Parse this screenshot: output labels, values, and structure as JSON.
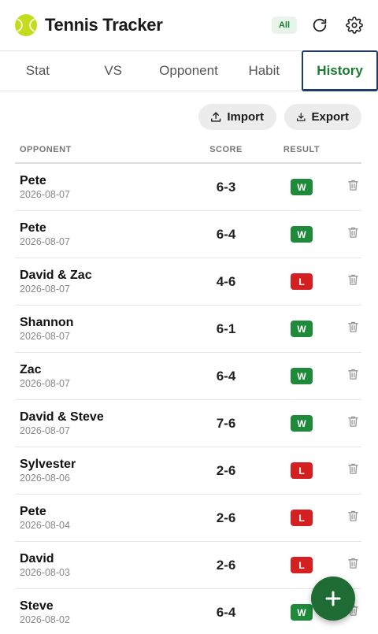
{
  "app": {
    "title": "Tennis Tracker",
    "filter_badge": "All"
  },
  "tabs": [
    {
      "label": "Stat",
      "active": false
    },
    {
      "label": "VS",
      "active": false
    },
    {
      "label": "Opponent",
      "active": false
    },
    {
      "label": "Habit",
      "active": false
    },
    {
      "label": "History",
      "active": true
    }
  ],
  "actions": {
    "import_label": "Import",
    "export_label": "Export"
  },
  "table": {
    "headers": {
      "opponent": "OPPONENT",
      "score": "SCORE",
      "result": "RESULT"
    },
    "rows": [
      {
        "opponent": "Pete",
        "date": "2026-08-07",
        "score": "6-3",
        "result": "W"
      },
      {
        "opponent": "Pete",
        "date": "2026-08-07",
        "score": "6-4",
        "result": "W"
      },
      {
        "opponent": "David & Zac",
        "date": "2026-08-07",
        "score": "4-6",
        "result": "L"
      },
      {
        "opponent": "Shannon",
        "date": "2026-08-07",
        "score": "6-1",
        "result": "W"
      },
      {
        "opponent": "Zac",
        "date": "2026-08-07",
        "score": "6-4",
        "result": "W"
      },
      {
        "opponent": "David & Steve",
        "date": "2026-08-07",
        "score": "7-6",
        "result": "W"
      },
      {
        "opponent": "Sylvester",
        "date": "2026-08-06",
        "score": "2-6",
        "result": "L"
      },
      {
        "opponent": "Pete",
        "date": "2026-08-04",
        "score": "2-6",
        "result": "L"
      },
      {
        "opponent": "David",
        "date": "2026-08-03",
        "score": "2-6",
        "result": "L"
      },
      {
        "opponent": "Steve",
        "date": "2026-08-02",
        "score": "6-4",
        "result": "W"
      }
    ]
  },
  "colors": {
    "win": "#1e8a3a",
    "loss": "#d42020",
    "accent": "#1c7a32",
    "fab": "#1e6b33"
  },
  "icons": {
    "logo": "tennis-ball-icon",
    "refresh": "refresh-icon",
    "settings": "gear-icon",
    "import": "upload-icon",
    "export": "download-icon",
    "delete": "trash-icon",
    "add": "plus-icon"
  }
}
